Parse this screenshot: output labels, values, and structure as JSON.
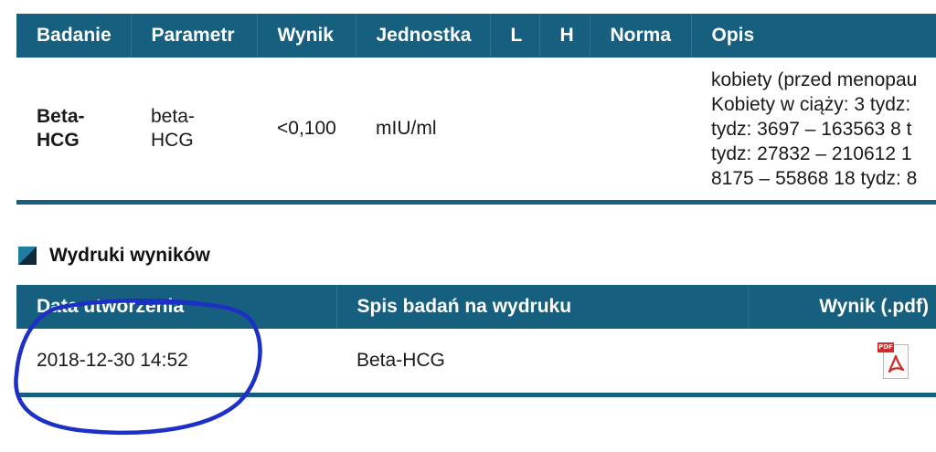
{
  "results_table": {
    "headers": [
      "Badanie",
      "Parametr",
      "Wynik",
      "Jednostka",
      "L",
      "H",
      "Norma",
      "Opis"
    ],
    "row": {
      "badanie": "Beta-\nHCG",
      "parametr": "beta-\nHCG",
      "wynik": "<0,100",
      "jednostka": "mIU/ml",
      "l": "",
      "h": "",
      "norma": "",
      "opis": "kobiety (przed menopau\nKobiety w ciąży: 3 tydz:\ntydz: 3697 – 163563 8 t\ntydz: 27832 – 210612 1\n8175 – 55868 18 tydz: 8"
    }
  },
  "section": {
    "title": "Wydruki wyników"
  },
  "prints_table": {
    "headers": [
      "Data utworzenia",
      "Spis badań na wydruku",
      "Wynik (.pdf)"
    ],
    "row": {
      "date": "2018-12-30 14:52",
      "tests": "Beta-HCG"
    }
  },
  "icons": {
    "section_marker": "square-marker-icon",
    "pdf": "pdf-file-icon",
    "pdf_tag": "PDF"
  },
  "colors": {
    "header_bg": "#175f7e",
    "accent": "#1f7da2",
    "scribble": "#1c2fc6",
    "pdf_red": "#d22a2a"
  }
}
